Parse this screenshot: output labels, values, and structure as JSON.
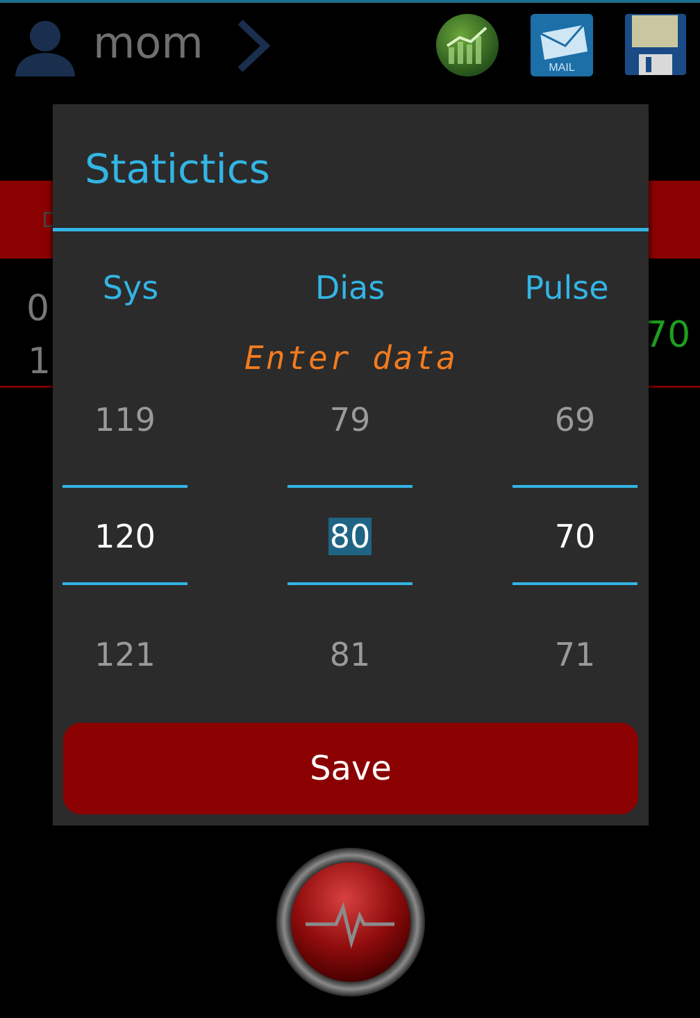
{
  "header": {
    "profile_name": "mom",
    "icons": [
      "avatar-icon",
      "chevron-right-icon",
      "stats-chart-icon",
      "mail-icon",
      "floppy-disk-icon"
    ],
    "mail_label": "MAIL"
  },
  "background_list": {
    "row_a": "0",
    "row_b": "1",
    "right_value": "70",
    "band_letter": "D"
  },
  "dialog": {
    "title": "Statictics",
    "columns": [
      "Sys",
      "Dias",
      "Pulse"
    ],
    "hint": "Enter data",
    "pickers": {
      "sys": {
        "prev": "119",
        "current": "120",
        "next": "121"
      },
      "dias": {
        "prev": "79",
        "current": "80",
        "next": "81"
      },
      "pulse": {
        "prev": "69",
        "current": "70",
        "next": "71"
      }
    },
    "save_label": "Save"
  },
  "colors": {
    "accent": "#33b5e5",
    "dialog_bg": "#2b2b2b",
    "save_bg": "#8b0000",
    "hint": "#f27b1f"
  }
}
